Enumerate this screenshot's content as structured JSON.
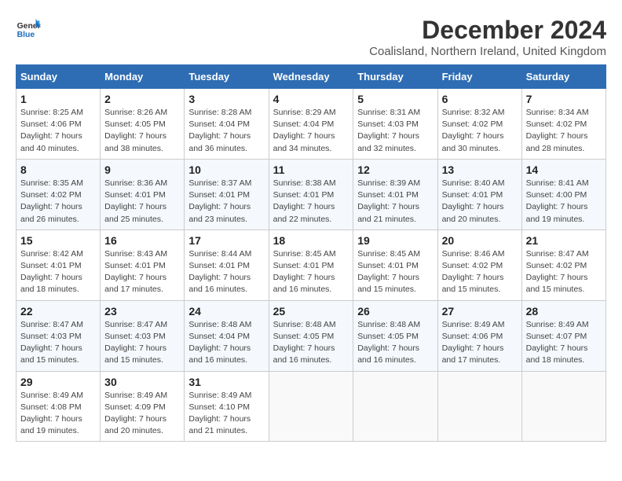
{
  "logo": {
    "line1": "General",
    "line2": "Blue"
  },
  "title": "December 2024",
  "subtitle": "Coalisland, Northern Ireland, United Kingdom",
  "days_of_week": [
    "Sunday",
    "Monday",
    "Tuesday",
    "Wednesday",
    "Thursday",
    "Friday",
    "Saturday"
  ],
  "weeks": [
    [
      {
        "day": "1",
        "sunrise": "Sunrise: 8:25 AM",
        "sunset": "Sunset: 4:06 PM",
        "daylight": "Daylight: 7 hours and 40 minutes."
      },
      {
        "day": "2",
        "sunrise": "Sunrise: 8:26 AM",
        "sunset": "Sunset: 4:05 PM",
        "daylight": "Daylight: 7 hours and 38 minutes."
      },
      {
        "day": "3",
        "sunrise": "Sunrise: 8:28 AM",
        "sunset": "Sunset: 4:04 PM",
        "daylight": "Daylight: 7 hours and 36 minutes."
      },
      {
        "day": "4",
        "sunrise": "Sunrise: 8:29 AM",
        "sunset": "Sunset: 4:04 PM",
        "daylight": "Daylight: 7 hours and 34 minutes."
      },
      {
        "day": "5",
        "sunrise": "Sunrise: 8:31 AM",
        "sunset": "Sunset: 4:03 PM",
        "daylight": "Daylight: 7 hours and 32 minutes."
      },
      {
        "day": "6",
        "sunrise": "Sunrise: 8:32 AM",
        "sunset": "Sunset: 4:02 PM",
        "daylight": "Daylight: 7 hours and 30 minutes."
      },
      {
        "day": "7",
        "sunrise": "Sunrise: 8:34 AM",
        "sunset": "Sunset: 4:02 PM",
        "daylight": "Daylight: 7 hours and 28 minutes."
      }
    ],
    [
      {
        "day": "8",
        "sunrise": "Sunrise: 8:35 AM",
        "sunset": "Sunset: 4:02 PM",
        "daylight": "Daylight: 7 hours and 26 minutes."
      },
      {
        "day": "9",
        "sunrise": "Sunrise: 8:36 AM",
        "sunset": "Sunset: 4:01 PM",
        "daylight": "Daylight: 7 hours and 25 minutes."
      },
      {
        "day": "10",
        "sunrise": "Sunrise: 8:37 AM",
        "sunset": "Sunset: 4:01 PM",
        "daylight": "Daylight: 7 hours and 23 minutes."
      },
      {
        "day": "11",
        "sunrise": "Sunrise: 8:38 AM",
        "sunset": "Sunset: 4:01 PM",
        "daylight": "Daylight: 7 hours and 22 minutes."
      },
      {
        "day": "12",
        "sunrise": "Sunrise: 8:39 AM",
        "sunset": "Sunset: 4:01 PM",
        "daylight": "Daylight: 7 hours and 21 minutes."
      },
      {
        "day": "13",
        "sunrise": "Sunrise: 8:40 AM",
        "sunset": "Sunset: 4:01 PM",
        "daylight": "Daylight: 7 hours and 20 minutes."
      },
      {
        "day": "14",
        "sunrise": "Sunrise: 8:41 AM",
        "sunset": "Sunset: 4:00 PM",
        "daylight": "Daylight: 7 hours and 19 minutes."
      }
    ],
    [
      {
        "day": "15",
        "sunrise": "Sunrise: 8:42 AM",
        "sunset": "Sunset: 4:01 PM",
        "daylight": "Daylight: 7 hours and 18 minutes."
      },
      {
        "day": "16",
        "sunrise": "Sunrise: 8:43 AM",
        "sunset": "Sunset: 4:01 PM",
        "daylight": "Daylight: 7 hours and 17 minutes."
      },
      {
        "day": "17",
        "sunrise": "Sunrise: 8:44 AM",
        "sunset": "Sunset: 4:01 PM",
        "daylight": "Daylight: 7 hours and 16 minutes."
      },
      {
        "day": "18",
        "sunrise": "Sunrise: 8:45 AM",
        "sunset": "Sunset: 4:01 PM",
        "daylight": "Daylight: 7 hours and 16 minutes."
      },
      {
        "day": "19",
        "sunrise": "Sunrise: 8:45 AM",
        "sunset": "Sunset: 4:01 PM",
        "daylight": "Daylight: 7 hours and 15 minutes."
      },
      {
        "day": "20",
        "sunrise": "Sunrise: 8:46 AM",
        "sunset": "Sunset: 4:02 PM",
        "daylight": "Daylight: 7 hours and 15 minutes."
      },
      {
        "day": "21",
        "sunrise": "Sunrise: 8:47 AM",
        "sunset": "Sunset: 4:02 PM",
        "daylight": "Daylight: 7 hours and 15 minutes."
      }
    ],
    [
      {
        "day": "22",
        "sunrise": "Sunrise: 8:47 AM",
        "sunset": "Sunset: 4:03 PM",
        "daylight": "Daylight: 7 hours and 15 minutes."
      },
      {
        "day": "23",
        "sunrise": "Sunrise: 8:47 AM",
        "sunset": "Sunset: 4:03 PM",
        "daylight": "Daylight: 7 hours and 15 minutes."
      },
      {
        "day": "24",
        "sunrise": "Sunrise: 8:48 AM",
        "sunset": "Sunset: 4:04 PM",
        "daylight": "Daylight: 7 hours and 16 minutes."
      },
      {
        "day": "25",
        "sunrise": "Sunrise: 8:48 AM",
        "sunset": "Sunset: 4:05 PM",
        "daylight": "Daylight: 7 hours and 16 minutes."
      },
      {
        "day": "26",
        "sunrise": "Sunrise: 8:48 AM",
        "sunset": "Sunset: 4:05 PM",
        "daylight": "Daylight: 7 hours and 16 minutes."
      },
      {
        "day": "27",
        "sunrise": "Sunrise: 8:49 AM",
        "sunset": "Sunset: 4:06 PM",
        "daylight": "Daylight: 7 hours and 17 minutes."
      },
      {
        "day": "28",
        "sunrise": "Sunrise: 8:49 AM",
        "sunset": "Sunset: 4:07 PM",
        "daylight": "Daylight: 7 hours and 18 minutes."
      }
    ],
    [
      {
        "day": "29",
        "sunrise": "Sunrise: 8:49 AM",
        "sunset": "Sunset: 4:08 PM",
        "daylight": "Daylight: 7 hours and 19 minutes."
      },
      {
        "day": "30",
        "sunrise": "Sunrise: 8:49 AM",
        "sunset": "Sunset: 4:09 PM",
        "daylight": "Daylight: 7 hours and 20 minutes."
      },
      {
        "day": "31",
        "sunrise": "Sunrise: 8:49 AM",
        "sunset": "Sunset: 4:10 PM",
        "daylight": "Daylight: 7 hours and 21 minutes."
      },
      null,
      null,
      null,
      null
    ]
  ]
}
